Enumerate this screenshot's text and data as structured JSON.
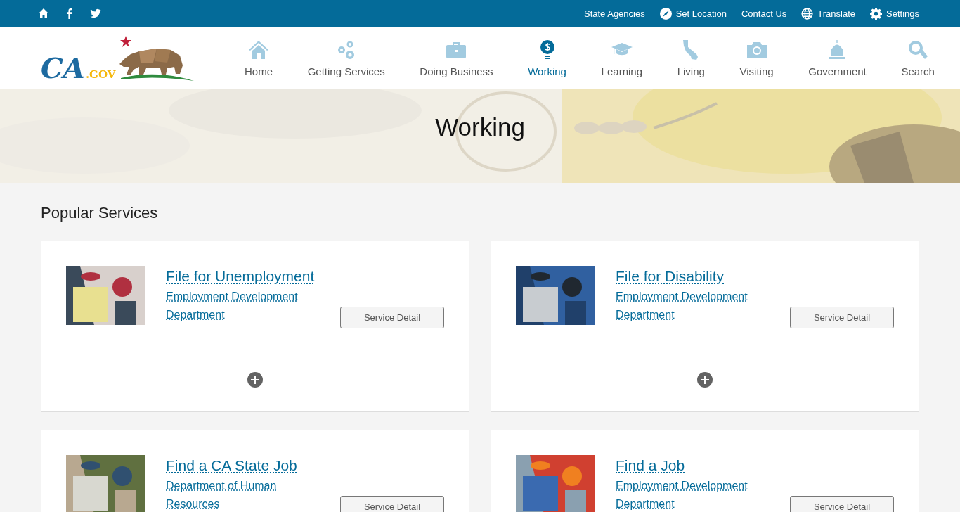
{
  "top_bar": {
    "social": [
      {
        "kind": "home"
      },
      {
        "kind": "facebook"
      },
      {
        "kind": "twitter"
      }
    ],
    "links": [
      {
        "label": "State Agencies"
      },
      {
        "label": "Set Location"
      },
      {
        "label": "Contact Us"
      },
      {
        "label": "Translate"
      },
      {
        "label": "Settings"
      }
    ]
  },
  "logo": {
    "main": "CA",
    "suffix": ".GOV"
  },
  "nav": [
    {
      "label": "Home",
      "selected": false
    },
    {
      "label": "Getting Services",
      "selected": false
    },
    {
      "label": "Doing Business",
      "selected": false
    },
    {
      "label": "Working",
      "selected": true
    },
    {
      "label": "Learning",
      "selected": false
    },
    {
      "label": "Living",
      "selected": false
    },
    {
      "label": "Visiting",
      "selected": false
    },
    {
      "label": "Government",
      "selected": false
    },
    {
      "label": "Search",
      "selected": false
    }
  ],
  "hero": {
    "title": "Working"
  },
  "section_title": "Popular Services",
  "cards": [
    {
      "title": "File for Unemployment",
      "agency": "Employment Development Department",
      "button": "Service Detail",
      "expandable": true
    },
    {
      "title": "File for Disability",
      "agency": "Employment Development Department",
      "button": "Service Detail",
      "expandable": true
    },
    {
      "title": "Find a CA State Job",
      "agency": "Department of Human Resources",
      "button": "Service Detail"
    },
    {
      "title": "Find a Job",
      "agency": "Employment Development Department",
      "button": "Service Detail"
    }
  ]
}
